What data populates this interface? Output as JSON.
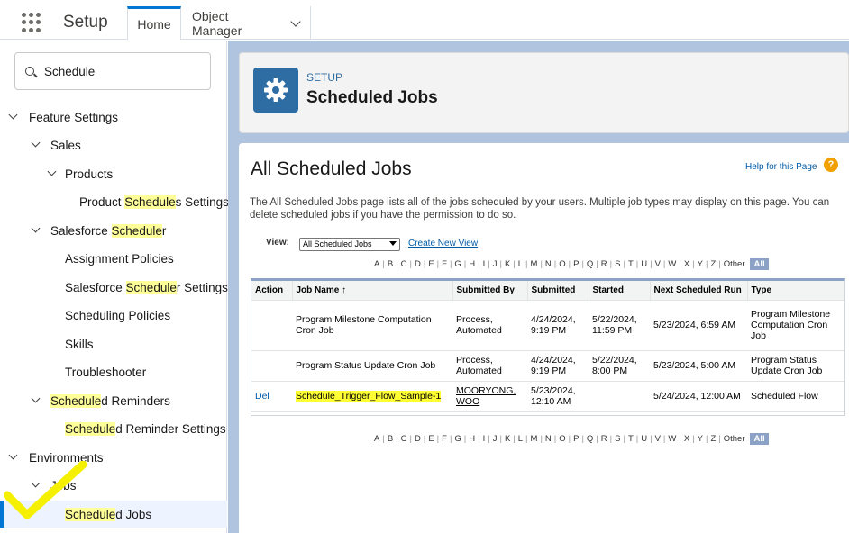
{
  "topbar": {
    "app_name": "Setup",
    "tabs": [
      {
        "label": "Home"
      },
      {
        "label": "Object Manager"
      }
    ]
  },
  "sidebar": {
    "search_value": "Schedule",
    "items": [
      {
        "pre": "Feature Settings",
        "hl": "",
        "post": ""
      },
      {
        "pre": "Sales",
        "hl": "",
        "post": ""
      },
      {
        "pre": "Products",
        "hl": "",
        "post": ""
      },
      {
        "pre": "Product ",
        "hl": "Schedule",
        "post": "s Settings"
      },
      {
        "pre": "Salesforce ",
        "hl": "Schedule",
        "post": "r"
      },
      {
        "pre": "Assignment Policies",
        "hl": "",
        "post": ""
      },
      {
        "pre": "Salesforce ",
        "hl": "Schedule",
        "post": "r Settings"
      },
      {
        "pre": "Scheduling Policies",
        "hl": "",
        "post": ""
      },
      {
        "pre": "Skills",
        "hl": "",
        "post": ""
      },
      {
        "pre": "Troubleshooter",
        "hl": "",
        "post": ""
      },
      {
        "pre": "",
        "hl": "Schedule",
        "post": "d Reminders"
      },
      {
        "pre": "",
        "hl": "Schedule",
        "post": "d Reminder Settings"
      },
      {
        "pre": "Environments",
        "hl": "",
        "post": ""
      },
      {
        "pre": "Jobs",
        "hl": "",
        "post": ""
      },
      {
        "pre": "",
        "hl": "Schedule",
        "post": "d Jobs"
      }
    ]
  },
  "header": {
    "eyebrow": "SETUP",
    "title": "Scheduled Jobs"
  },
  "content": {
    "title": "All Scheduled Jobs",
    "help_link": "Help for this Page",
    "help_icon": "?",
    "description": "The All Scheduled Jobs page lists all of the jobs scheduled by your users. Multiple job types may display on this page. You can delete scheduled jobs if you have the permission to do so.",
    "view_label": "View:",
    "view_selected": "All Scheduled Jobs",
    "create_view": "Create New View",
    "alphabet": [
      "A",
      "B",
      "C",
      "D",
      "E",
      "F",
      "G",
      "H",
      "I",
      "J",
      "K",
      "L",
      "M",
      "N",
      "O",
      "P",
      "Q",
      "R",
      "S",
      "T",
      "U",
      "V",
      "W",
      "X",
      "Y",
      "Z",
      "Other"
    ],
    "alphabet_all": "All"
  },
  "table": {
    "columns": [
      "Action",
      "Job Name ↑",
      "Submitted By",
      "Submitted",
      "Started",
      "Next Scheduled Run",
      "Type"
    ],
    "rows": [
      {
        "action": "",
        "job_name": "Program Milestone Computation Cron Job",
        "submitted_by": "Process, Automated",
        "submitted": "4/24/2024, 9:19 PM",
        "started": "5/22/2024, 11:59 PM",
        "next_run": "5/23/2024, 6:59 AM",
        "type": "Program Milestone Computation Cron Job"
      },
      {
        "action": "",
        "job_name": "Program Status Update Cron Job",
        "submitted_by": "Process, Automated",
        "submitted": "4/24/2024, 9:19 PM",
        "started": "5/22/2024, 8:00 PM",
        "next_run": "5/23/2024, 5:00 AM",
        "type": "Program Status Update Cron Job"
      },
      {
        "action": "Del",
        "job_name": "Schedule_Trigger_Flow_Sample-1",
        "submitted_by": "MOORYONG, WOO",
        "submitted": "5/23/2024, 12:10 AM",
        "started": "",
        "next_run": "5/24/2024, 12:00 AM",
        "type": "Scheduled Flow"
      }
    ]
  },
  "colors": {
    "accent": "#0176d3",
    "highlight": "#ffff99",
    "header_icon": "#2e6da4",
    "annotation_check": "#f5f000"
  }
}
